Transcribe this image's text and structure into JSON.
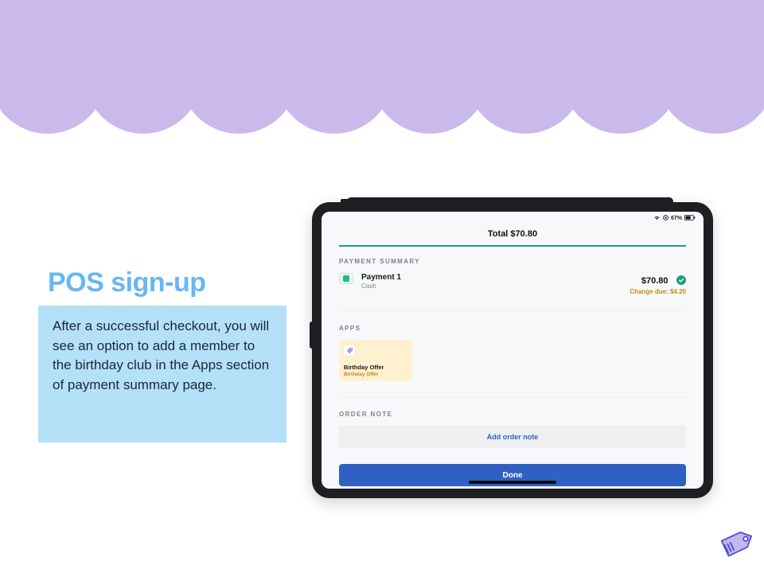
{
  "colors": {
    "header_purple": "#cab9eb",
    "title_blue": "#67b6f5",
    "callout_blue": "#b4e0f8",
    "accent_green": "#1aa37a",
    "accent_amber": "#c58a14",
    "primary_button": "#3160c4"
  },
  "title": "POS sign-up",
  "callout_text": "After a successful checkout, you will see an option to add a member to the birthday club in the Apps section of payment summary page.",
  "statusbar": {
    "battery_pct": "67%"
  },
  "total_label": "Total $70.80",
  "sections": {
    "payment_summary_label": "PAYMENT SUMMARY",
    "apps_label": "APPS",
    "order_note_label": "ORDER NOTE"
  },
  "payment": {
    "title": "Payment 1",
    "method": "Cash",
    "amount": "$70.80",
    "change_due": "Change due: $4.20"
  },
  "apps_card": {
    "title": "Birthday Offer",
    "subtitle": "Birthday Offer"
  },
  "buttons": {
    "add_order_note": "Add order note",
    "done": "Done"
  },
  "corner_icon_name": "price-tag-icon"
}
